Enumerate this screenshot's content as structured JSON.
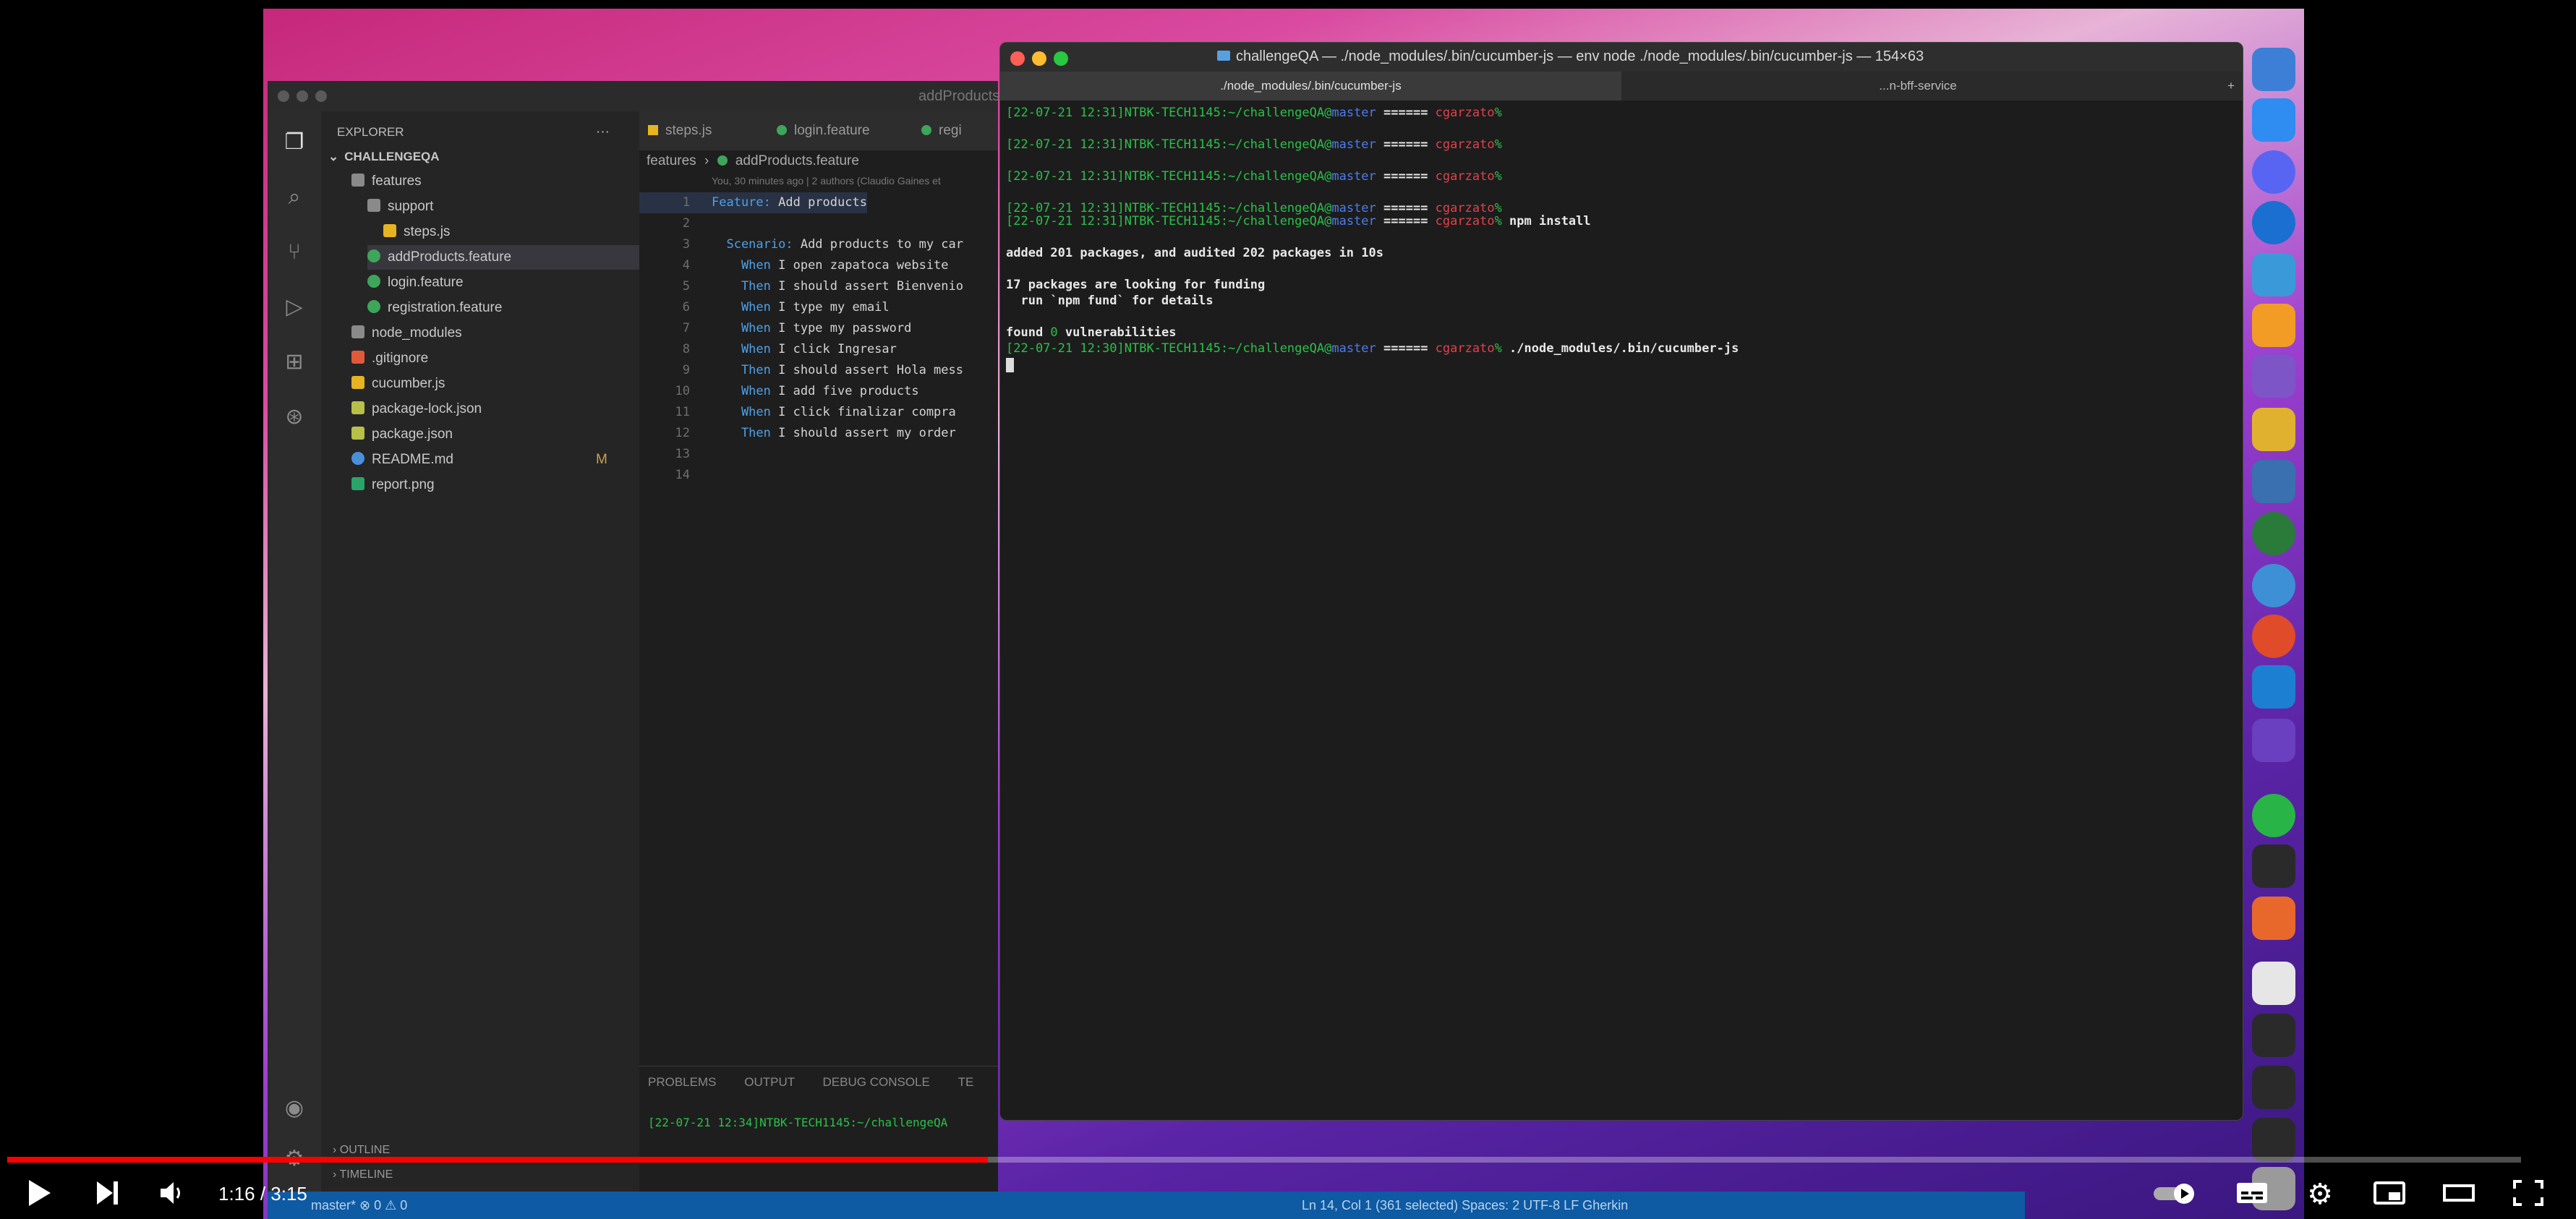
{
  "vscode": {
    "title": "addProducts",
    "explorer_title": "EXPLORER",
    "root": "CHALLENGEQA",
    "tree": [
      {
        "label": "features",
        "level": 1,
        "kind": "folder"
      },
      {
        "label": "support",
        "level": 2,
        "kind": "folder"
      },
      {
        "label": "steps.js",
        "level": 3,
        "kind": "js"
      },
      {
        "label": "addProducts.feature",
        "level": 2,
        "kind": "feature"
      },
      {
        "label": "login.feature",
        "level": 2,
        "kind": "feature"
      },
      {
        "label": "registration.feature",
        "level": 2,
        "kind": "feature"
      },
      {
        "label": "node_modules",
        "level": 1,
        "kind": "folder"
      },
      {
        "label": ".gitignore",
        "level": 1,
        "kind": "git"
      },
      {
        "label": "cucumber.js",
        "level": 1,
        "kind": "js"
      },
      {
        "label": "package-lock.json",
        "level": 1,
        "kind": "json"
      },
      {
        "label": "package.json",
        "level": 1,
        "kind": "json"
      },
      {
        "label": "README.md",
        "level": 1,
        "kind": "md",
        "badge": "M"
      },
      {
        "label": "report.png",
        "level": 1,
        "kind": "png"
      }
    ],
    "tabs": [
      "steps.js",
      "login.feature",
      "regi"
    ],
    "breadcrumb": [
      "features",
      "addProducts.feature"
    ],
    "blame": "You, 30 minutes ago | 2 authors (Claudio Gaines et",
    "code": [
      {
        "n": "1",
        "kw": "Feature:",
        "text": " Add products"
      },
      {
        "n": "2",
        "kw": "",
        "text": ""
      },
      {
        "n": "3",
        "kw": "  Scenario:",
        "text": " Add products to my car"
      },
      {
        "n": "4",
        "kw": "    When",
        "text": " I open zapatoca website"
      },
      {
        "n": "5",
        "kw": "    Then",
        "text": " I should assert Bienvenio"
      },
      {
        "n": "6",
        "kw": "    When",
        "text": " I type my email"
      },
      {
        "n": "7",
        "kw": "    When",
        "text": " I type my password"
      },
      {
        "n": "8",
        "kw": "    When",
        "text": " I click Ingresar"
      },
      {
        "n": "9",
        "kw": "    Then",
        "text": " I should assert Hola mess"
      },
      {
        "n": "10",
        "kw": "    When",
        "text": " I add five products"
      },
      {
        "n": "11",
        "kw": "    When",
        "text": " I click finalizar compra"
      },
      {
        "n": "12",
        "kw": "    Then",
        "text": " I should assert my order"
      },
      {
        "n": "13",
        "kw": "",
        "text": ""
      },
      {
        "n": "14",
        "kw": "",
        "text": ""
      }
    ],
    "panel_tabs": [
      "PROBLEMS",
      "OUTPUT",
      "DEBUG CONSOLE",
      "TE"
    ],
    "panel_line": "[22-07-21 12:34]NTBK-TECH1145:~/challengeQA",
    "outline": "OUTLINE",
    "timeline": "TIMELINE",
    "status_left": "master*  ⊗ 0 ⚠ 0",
    "status_right": "Ln 14, Col 1 (361 selected)   Spaces: 2   UTF-8   LF   Gherkin"
  },
  "terminal": {
    "title": "challengeQA — ./node_modules/.bin/cucumber-js — env node ./node_modules/.bin/cucumber-js — 154×63",
    "tabs": [
      "./node_modules/.bin/cucumber-js",
      "...n-bff-service"
    ],
    "prompt_date": "[22-07-21 12:31]",
    "host": "NTBK-TECH1145:~/challengeQA",
    "branch": "master",
    "user": "cgarzato",
    "lines": [
      {
        "kind": "prompt",
        "date": "[22-07-21 12:31]",
        "cmd": ""
      },
      {
        "kind": "prompt",
        "date": "[22-07-21 12:31]",
        "cmd": ""
      },
      {
        "kind": "prompt",
        "date": "[22-07-21 12:31]",
        "cmd": ""
      },
      {
        "kind": "prompt",
        "date": "[22-07-21 12:31]",
        "cmd": ""
      },
      {
        "kind": "prompt",
        "date": "[22-07-21 12:31]",
        "cmd": " npm install"
      },
      {
        "kind": "text",
        "text": ""
      },
      {
        "kind": "text",
        "text": "added 201 packages, and audited 202 packages in 10s"
      },
      {
        "kind": "text",
        "text": ""
      },
      {
        "kind": "text",
        "text": "17 packages are looking for funding"
      },
      {
        "kind": "text",
        "text": "  run `npm fund` for details"
      },
      {
        "kind": "text",
        "text": ""
      },
      {
        "kind": "found",
        "text": "found ",
        "zero": "0",
        "rest": " vulnerabilities"
      },
      {
        "kind": "prompt",
        "date": "[22-07-21 12:30]",
        "cmd": " ./node_modules/.bin/cucumber-js"
      }
    ]
  },
  "player": {
    "time": "1:16 / 3:15",
    "progress_fraction": 0.39,
    "play_icon": "play-icon",
    "next_icon": "next-icon",
    "volume_icon": "volume-icon",
    "autoplay_icon": "autoplay-toggle-icon",
    "captions_icon": "captions-icon",
    "settings_icon": "gear-icon",
    "miniplayer_icon": "miniplayer-icon",
    "theater_icon": "theater-icon",
    "fullscreen_icon": "fullscreen-icon"
  },
  "colors": {
    "progress": "#ff0000",
    "status_bar": "#0e5aa3",
    "prompt_green": "#2cc04a",
    "prompt_blue": "#4d7cf0",
    "prompt_red": "#e0424c"
  }
}
